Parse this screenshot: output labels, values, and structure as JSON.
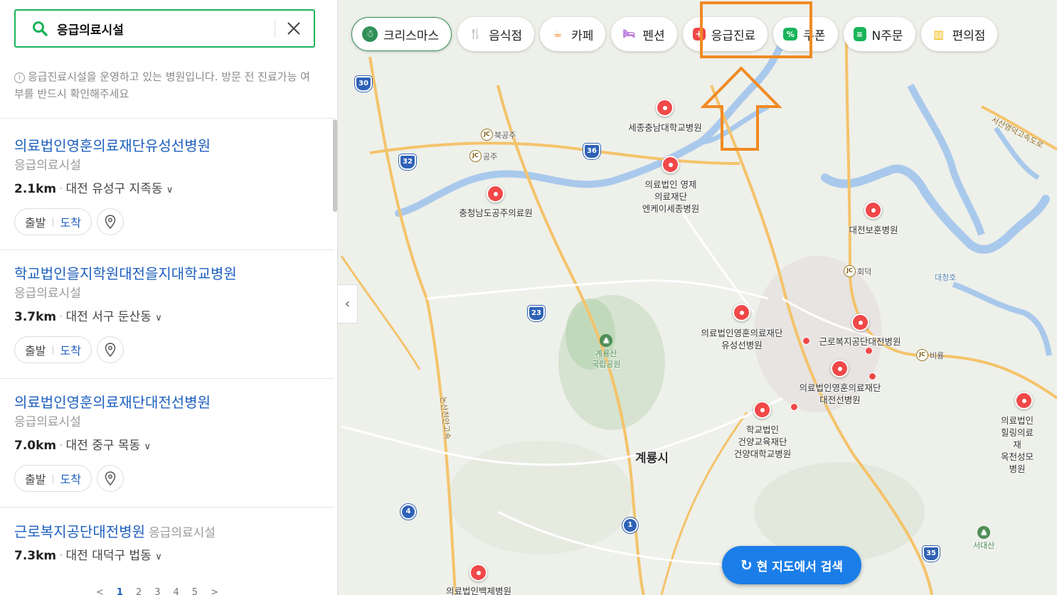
{
  "search": {
    "query": "응급의료시설"
  },
  "notice": {
    "icon": "info-icon",
    "text": "응급진료시설을 운영하고 있는 병원입니다. 방문 전 진료가능 여부를 반드시 확인해주세요"
  },
  "results": [
    {
      "name": "의료법인영훈의료재단유성선병원",
      "category": "응급의료시설",
      "distance": "2.1km",
      "address": "대전 유성구 지족동",
      "start": "출발",
      "arrive": "도착"
    },
    {
      "name": "학교법인을지학원대전을지대학교병원",
      "category": "응급의료시설",
      "distance": "3.7km",
      "address": "대전 서구 둔산동",
      "start": "출발",
      "arrive": "도착"
    },
    {
      "name": "의료법인영훈의료재단대전선병원",
      "category": "응급의료시설",
      "distance": "7.0km",
      "address": "대전 중구 목동",
      "start": "출발",
      "arrive": "도착"
    },
    {
      "name": "근로복지공단대전병원",
      "category": "응급의료시설",
      "distance": "7.3km",
      "address": "대전 대덕구 법동",
      "start": "출발",
      "arrive": "도착"
    }
  ],
  "pagination": [
    "<",
    "1",
    "2",
    "3",
    "4",
    "5",
    ">"
  ],
  "chips": [
    {
      "label": "크리스마스",
      "icon": "santa-icon",
      "color": "#2f8f55",
      "active": true
    },
    {
      "label": "음식점",
      "icon": "fork-knife-icon",
      "color": "#f08a24"
    },
    {
      "label": "카페",
      "icon": "coffee-cup-icon",
      "color": "#f08a24"
    },
    {
      "label": "펜션",
      "icon": "bed-icon",
      "color": "#b066d6"
    },
    {
      "label": "응급진료",
      "icon": "medical-cross-icon",
      "color": "#f14848"
    },
    {
      "label": "쿠폰",
      "icon": "coupon-icon",
      "color": "#19b45a"
    },
    {
      "label": "N주문",
      "icon": "order-icon",
      "color": "#19b45a"
    },
    {
      "label": "편의점",
      "icon": "store-icon",
      "color": "#f0b400"
    }
  ],
  "map_search_button": "현 지도에서 검색",
  "map": {
    "pois_major": [
      {
        "label": "세종충남대학교병원"
      },
      {
        "label": "의료법인 영제\n의료재단\n엔케이세종병원"
      },
      {
        "label": "충청남도공주의료원"
      },
      {
        "label": "대전보훈병원"
      },
      {
        "label": "의료법인영훈의료재단\n유성선병원"
      },
      {
        "label": "근로복지공단대전병원"
      },
      {
        "label": "의료법인영훈의료재단\n대전선병원"
      },
      {
        "label": "학교법인\n건양교육재단\n건양대학교병원"
      },
      {
        "label": "의료법인힐링의료재\n옥천성모병원"
      },
      {
        "label": "의료법인백제병원"
      }
    ],
    "places": [
      "북공주",
      "공주",
      "회덕",
      "비룡",
      "대청호",
      "서산영덕고속도로",
      "계룡산\n국립공원",
      "서대산",
      "논산천안고속"
    ],
    "city": "계룡시",
    "highways": [
      "30",
      "32",
      "36",
      "23",
      "35"
    ],
    "national_roads": [
      "4",
      "1"
    ],
    "jc_label": "JC"
  }
}
